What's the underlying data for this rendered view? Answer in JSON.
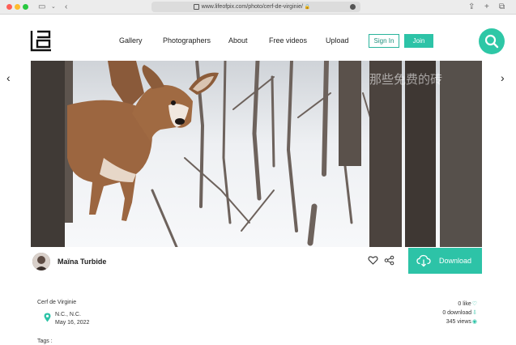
{
  "browser": {
    "url": "www.lifeofpix.com/photo/cerf-de-virginie/",
    "lock_glyph": "🔒"
  },
  "nav": {
    "items": [
      "Gallery",
      "Photographers",
      "About",
      "Free videos",
      "Upload"
    ],
    "signin_label": "Sign In",
    "join_label": "Join"
  },
  "photo": {
    "watermark": "那些免费的砖"
  },
  "author": {
    "name": "Maïna Turbide"
  },
  "actions": {
    "download_label": "Download"
  },
  "details": {
    "title": "Cerf de Virginie",
    "location": "N.C., N.C.",
    "date": "May 16, 2022",
    "likes": "0 like",
    "downloads": "0 download",
    "views": "345 views",
    "tags_label": "Tags :"
  },
  "colors": {
    "accent": "#2dc3a7"
  },
  "icons": [
    "logo-icon",
    "search-icon",
    "heart-icon",
    "share-icon",
    "cloud-download-icon",
    "location-pin-icon"
  ]
}
